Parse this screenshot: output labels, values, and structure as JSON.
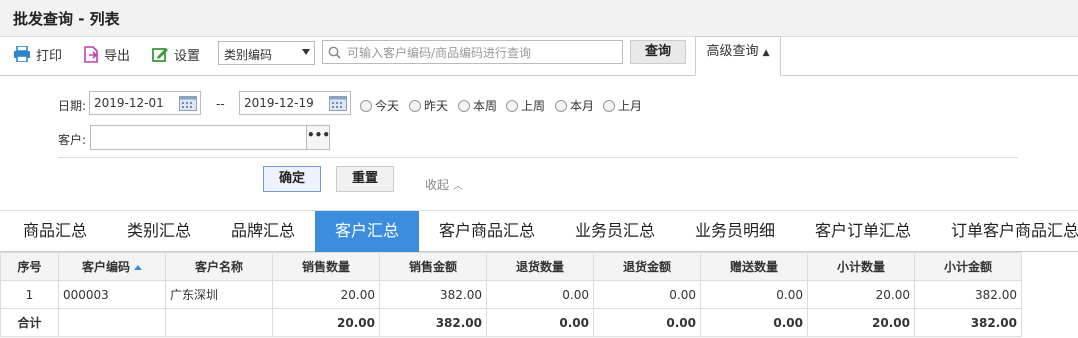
{
  "title": "批发查询 - 列表",
  "toolbar": {
    "print": "打印",
    "export": "导出",
    "settings": "设置",
    "category_select": "类别编码",
    "search_placeholder": "可输入客户编码/商品编码进行查询",
    "query": "查询",
    "advanced": "高级查询"
  },
  "filter": {
    "date_label": "日期:",
    "date_from": "2019-12-01",
    "date_sep": "--",
    "date_to": "2019-12-19",
    "radios": [
      "今天",
      "昨天",
      "本周",
      "上周",
      "本月",
      "上月"
    ],
    "customer_label": "客户:",
    "customer_value": "",
    "more": "•••",
    "ok": "确定",
    "reset": "重置",
    "collapse": "收起"
  },
  "tabs": [
    "商品汇总",
    "类别汇总",
    "品牌汇总",
    "客户汇总",
    "客户商品汇总",
    "业务员汇总",
    "业务员明细",
    "客户订单汇总",
    "订单客户商品汇总"
  ],
  "active_tab": "客户汇总",
  "table": {
    "headers": [
      "序号",
      "客户编码",
      "客户名称",
      "销售数量",
      "销售金额",
      "退货数量",
      "退货金额",
      "赠送数量",
      "小计数量",
      "小计金额"
    ],
    "rows": [
      [
        "1",
        "000003",
        "广东深圳",
        "20.00",
        "382.00",
        "0.00",
        "0.00",
        "0.00",
        "20.00",
        "382.00"
      ]
    ],
    "total": [
      "合计",
      "",
      "",
      "20.00",
      "382.00",
      "0.00",
      "0.00",
      "0.00",
      "20.00",
      "382.00"
    ]
  },
  "colors": {
    "accent": "#3c8ddc",
    "print_icon": "#2a86c8",
    "export_icon": "#c040a8",
    "settings_icon": "#3a9a3a"
  }
}
